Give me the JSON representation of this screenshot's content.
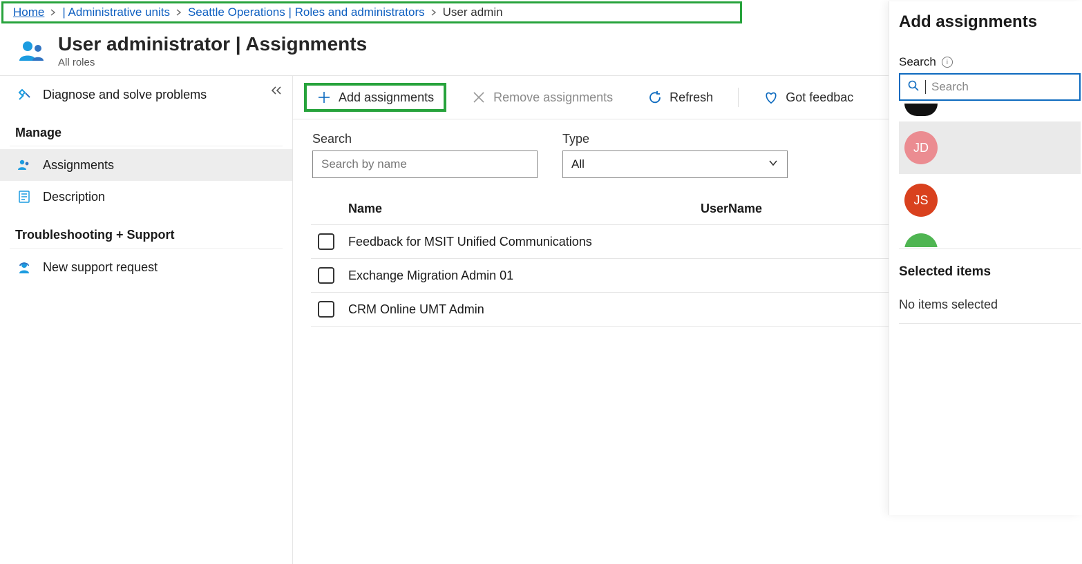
{
  "breadcrumb": {
    "home": "Home",
    "admin_units": "| Administrative units",
    "seattle": "Seattle Operations | Roles and administrators",
    "current": "User admin"
  },
  "page": {
    "title": "User administrator | Assignments",
    "subtitle": "All roles"
  },
  "sidebar": {
    "diagnose": "Diagnose and solve problems",
    "manage_heading": "Manage",
    "assignments": "Assignments",
    "description": "Description",
    "troubleshoot_heading": "Troubleshooting + Support",
    "support": "New support request"
  },
  "toolbar": {
    "add": "Add assignments",
    "remove": "Remove assignments",
    "refresh": "Refresh",
    "feedback": "Got feedbac"
  },
  "filters": {
    "search_label": "Search",
    "search_placeholder": "Search by name",
    "type_label": "Type",
    "type_value": "All"
  },
  "grid": {
    "col_name": "Name",
    "col_user": "UserName",
    "rows": [
      {
        "name": "Feedback for MSIT Unified Communications"
      },
      {
        "name": "Exchange Migration Admin 01"
      },
      {
        "name": "CRM Online UMT Admin"
      }
    ]
  },
  "panel": {
    "title": "Add assignments",
    "search_label": "Search",
    "search_placeholder": "Search",
    "results": [
      {
        "initials": "JD",
        "color": "pink"
      },
      {
        "initials": "JS",
        "color": "orange"
      }
    ],
    "selected_title": "Selected items",
    "selected_empty": "No items selected"
  }
}
